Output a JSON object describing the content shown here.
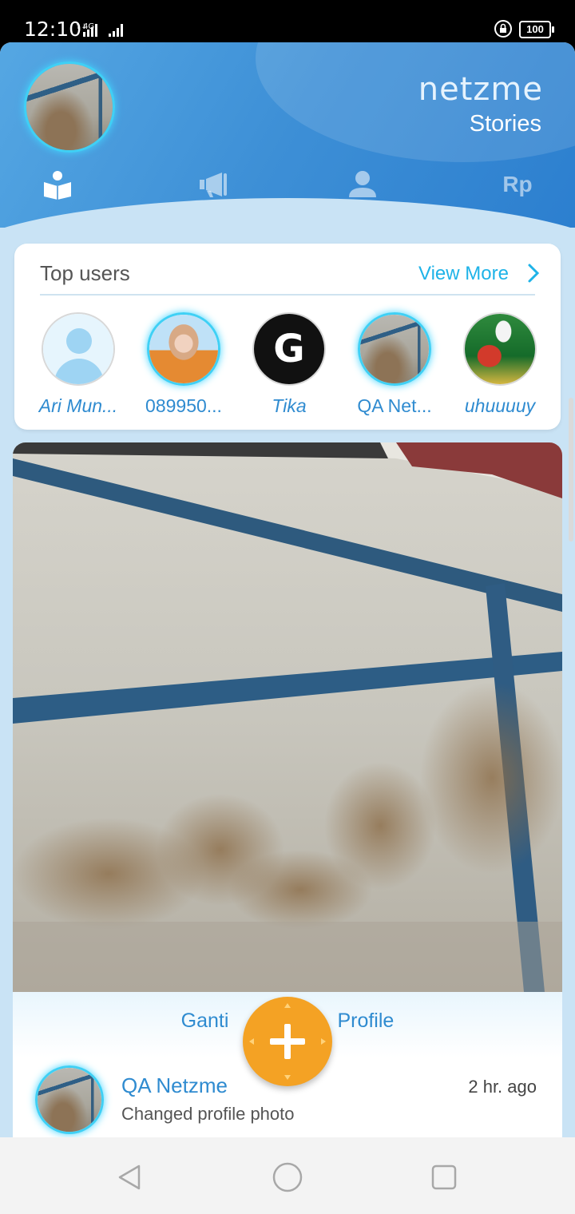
{
  "status_bar": {
    "time": "12:10",
    "network": "4G",
    "battery": "100"
  },
  "header": {
    "brand": "netzme",
    "section": "Stories",
    "tabs": [
      {
        "icon": "book-reader-icon",
        "active": true
      },
      {
        "icon": "megaphone-icon",
        "active": false
      },
      {
        "icon": "person-icon",
        "active": false
      },
      {
        "label": "Rp",
        "icon": "rupiah-icon",
        "active": false
      }
    ]
  },
  "top_users": {
    "title": "Top users",
    "view_more": "View More",
    "users": [
      {
        "name": "Ari Mun...",
        "avatar": "default-user-icon"
      },
      {
        "name": "089950...",
        "avatar": "photo"
      },
      {
        "name": "Tika",
        "avatar": "letter",
        "letter": "G"
      },
      {
        "name": "QA Net...",
        "avatar": "photo"
      },
      {
        "name": "uhuuuuy",
        "avatar": "photo"
      }
    ]
  },
  "story": {
    "caption_left": "Ganti",
    "caption_right": "Profile",
    "author": "QA Netzme",
    "action": "Changed profile photo",
    "time": "2 hr. ago"
  },
  "colors": {
    "header_blue": "#3d8fd6",
    "link_blue": "#2f8bd0",
    "view_more": "#1eb3e8",
    "fab_orange": "#f4a224",
    "avatar_glow": "#3fd0f5"
  }
}
